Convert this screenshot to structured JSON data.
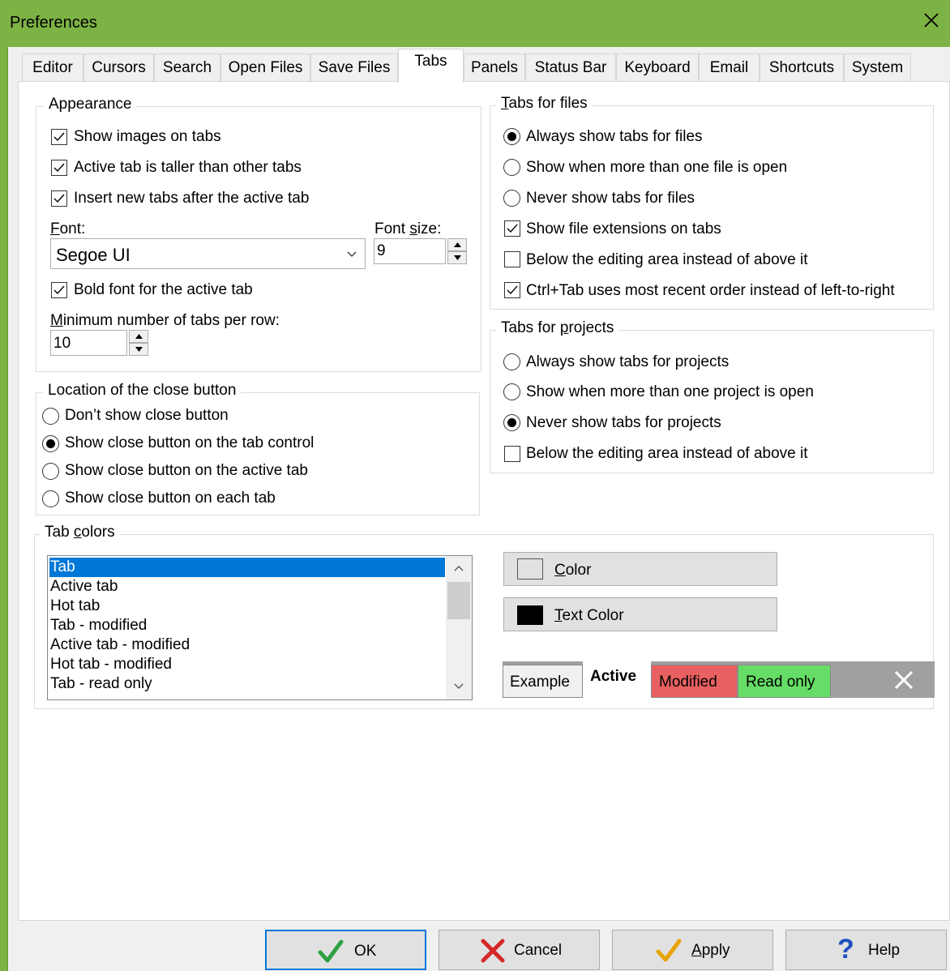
{
  "window": {
    "title": "Preferences"
  },
  "tabs": [
    "Editor",
    "Cursors",
    "Search",
    "Open Files",
    "Save Files",
    "Tabs",
    "Panels",
    "Status Bar",
    "Keyboard",
    "Email",
    "Shortcuts",
    "System"
  ],
  "active_tab": "Tabs",
  "appearance": {
    "legend": "Appearance",
    "show_images": {
      "label": "Show images on tabs",
      "checked": true
    },
    "active_taller": {
      "label": "Active tab is taller than other tabs",
      "checked": true
    },
    "insert_after": {
      "label": "Insert new tabs after the active tab",
      "checked": true
    },
    "font_label_first": "F",
    "font_label_rest": "ont:",
    "font_value": "Segoe UI",
    "font_size_label_pre": "Font ",
    "font_size_label_s": "s",
    "font_size_label_rest": "ize:",
    "font_size_value": "9",
    "bold_active": {
      "label": "Bold font for the active tab",
      "checked": true
    },
    "min_tabs_label_first": "M",
    "min_tabs_label_rest": "inimum number of tabs per row:",
    "min_tabs_value": "10"
  },
  "close_location": {
    "legend": "Location of the close button",
    "options": [
      {
        "label": "Don’t show close button",
        "selected": false
      },
      {
        "label": "Show close button on the tab control",
        "selected": true
      },
      {
        "label": "Show close button on the active tab",
        "selected": false
      },
      {
        "label": "Show close button on each tab",
        "selected": false
      }
    ]
  },
  "tabs_for_files": {
    "legend_first": "T",
    "legend_rest": "abs for files",
    "always": {
      "label": "Always show tabs for files",
      "selected": true
    },
    "more_than_one": {
      "label": "Show when more than one file is open",
      "selected": false
    },
    "never": {
      "label": "Never show tabs for files",
      "selected": false
    },
    "extensions": {
      "label": "Show file extensions on tabs",
      "checked": true
    },
    "below": {
      "label": "Below the editing area instead of above it",
      "checked": false
    },
    "ctrl_tab": {
      "label": "Ctrl+Tab uses most recent order instead of left-to-right",
      "checked": true
    }
  },
  "tabs_for_projects": {
    "legend_pre": "Tabs for ",
    "legend_p": "p",
    "legend_rest": "rojects",
    "always": {
      "label": "Always show tabs for projects",
      "selected": false
    },
    "more_than_one": {
      "label": "Show when more than one project is open",
      "selected": false
    },
    "never": {
      "label": "Never show tabs for projects",
      "selected": true
    },
    "below": {
      "label": "Below the editing area instead of above it",
      "checked": false
    }
  },
  "tab_colors": {
    "legend_pre": "Tab ",
    "legend_c": "c",
    "legend_rest": "olors",
    "items": [
      "Tab",
      "Active tab",
      "Hot tab",
      "Tab - modified",
      "Active tab - modified",
      "Hot tab - modified",
      "Tab - read only"
    ],
    "selected_index": 0,
    "color_btn_first": "C",
    "color_btn_rest": "olor",
    "text_color_btn_first": "T",
    "text_color_btn_rest": "ext Color",
    "swatch_color": "#ffffff",
    "swatch_text_color": "#000000",
    "preview": {
      "example": "Example",
      "active": "Active",
      "modified": "Modified",
      "read_only": "Read only",
      "modified_color": "#e86060",
      "read_only_color": "#66dd66"
    }
  },
  "buttons": {
    "ok": "OK",
    "cancel": "Cancel",
    "apply_first": "A",
    "apply_rest": "pply",
    "help": "Help"
  },
  "colors": {
    "titlebar": "#7db244",
    "selection": "#0078d7"
  }
}
